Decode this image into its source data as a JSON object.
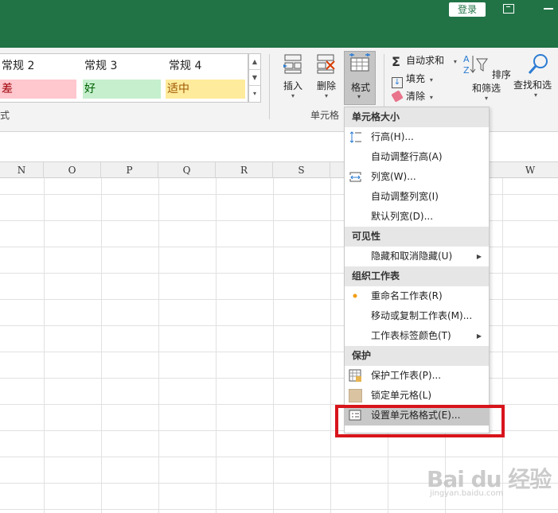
{
  "titlebar": {
    "login_label": "登录"
  },
  "ribbon": {
    "cell_styles": [
      {
        "label": "常规 2",
        "bg": "#ffffff",
        "fg": "#000000"
      },
      {
        "label": "常规 3",
        "bg": "#ffffff",
        "fg": "#000000"
      },
      {
        "label": "常规 4",
        "bg": "#ffffff",
        "fg": "#000000"
      },
      {
        "label": "差",
        "bg": "#ffc7ce",
        "fg": "#9c0006"
      },
      {
        "label": "好",
        "bg": "#c6efce",
        "fg": "#006100"
      },
      {
        "label": "适中",
        "bg": "#ffeb9c",
        "fg": "#9c5700"
      }
    ],
    "styles_group_label": "式",
    "cells_group_label": "单元格",
    "insert_label": "插入",
    "delete_label": "删除",
    "format_label": "格式",
    "autosum_label": "自动求和",
    "fill_label": "填充",
    "clear_label": "清除",
    "sort_filter_label": "排序和筛选",
    "find_select_label": "查找和选"
  },
  "columns": [
    "N",
    "O",
    "P",
    "Q",
    "R",
    "S",
    "W"
  ],
  "menu": {
    "sections": [
      {
        "header": "单元格大小",
        "items": [
          {
            "label": "行高(H)...",
            "icon": "row-height-icon",
            "arrow": false
          },
          {
            "label": "自动调整行高(A)",
            "icon": "",
            "arrow": false
          },
          {
            "label": "列宽(W)...",
            "icon": "column-width-icon",
            "arrow": false
          },
          {
            "label": "自动调整列宽(I)",
            "icon": "",
            "arrow": false
          },
          {
            "label": "默认列宽(D)...",
            "icon": "",
            "arrow": false
          }
        ]
      },
      {
        "header": "可见性",
        "items": [
          {
            "label": "隐藏和取消隐藏(U)",
            "icon": "",
            "arrow": true
          }
        ]
      },
      {
        "header": "组织工作表",
        "items": [
          {
            "label": "重命名工作表(R)",
            "icon": "bullet-icon",
            "arrow": false
          },
          {
            "label": "移动或复制工作表(M)...",
            "icon": "",
            "arrow": false
          },
          {
            "label": "工作表标签颜色(T)",
            "icon": "",
            "arrow": true
          }
        ]
      },
      {
        "header": "保护",
        "items": [
          {
            "label": "保护工作表(P)...",
            "icon": "protect-sheet-icon",
            "arrow": false
          },
          {
            "label": "锁定单元格(L)",
            "icon": "lock-cell-icon",
            "arrow": false
          },
          {
            "label": "设置单元格格式(E)...",
            "icon": "format-cells-icon",
            "arrow": false,
            "highlighted": true
          }
        ]
      }
    ]
  },
  "watermark": {
    "text": "Bai du 经验",
    "sub": "jingyan.baidu.com"
  },
  "colors": {
    "excel_green": "#217346",
    "highlight_red": "#d8141b",
    "orange_bullet": "#f39c12"
  }
}
